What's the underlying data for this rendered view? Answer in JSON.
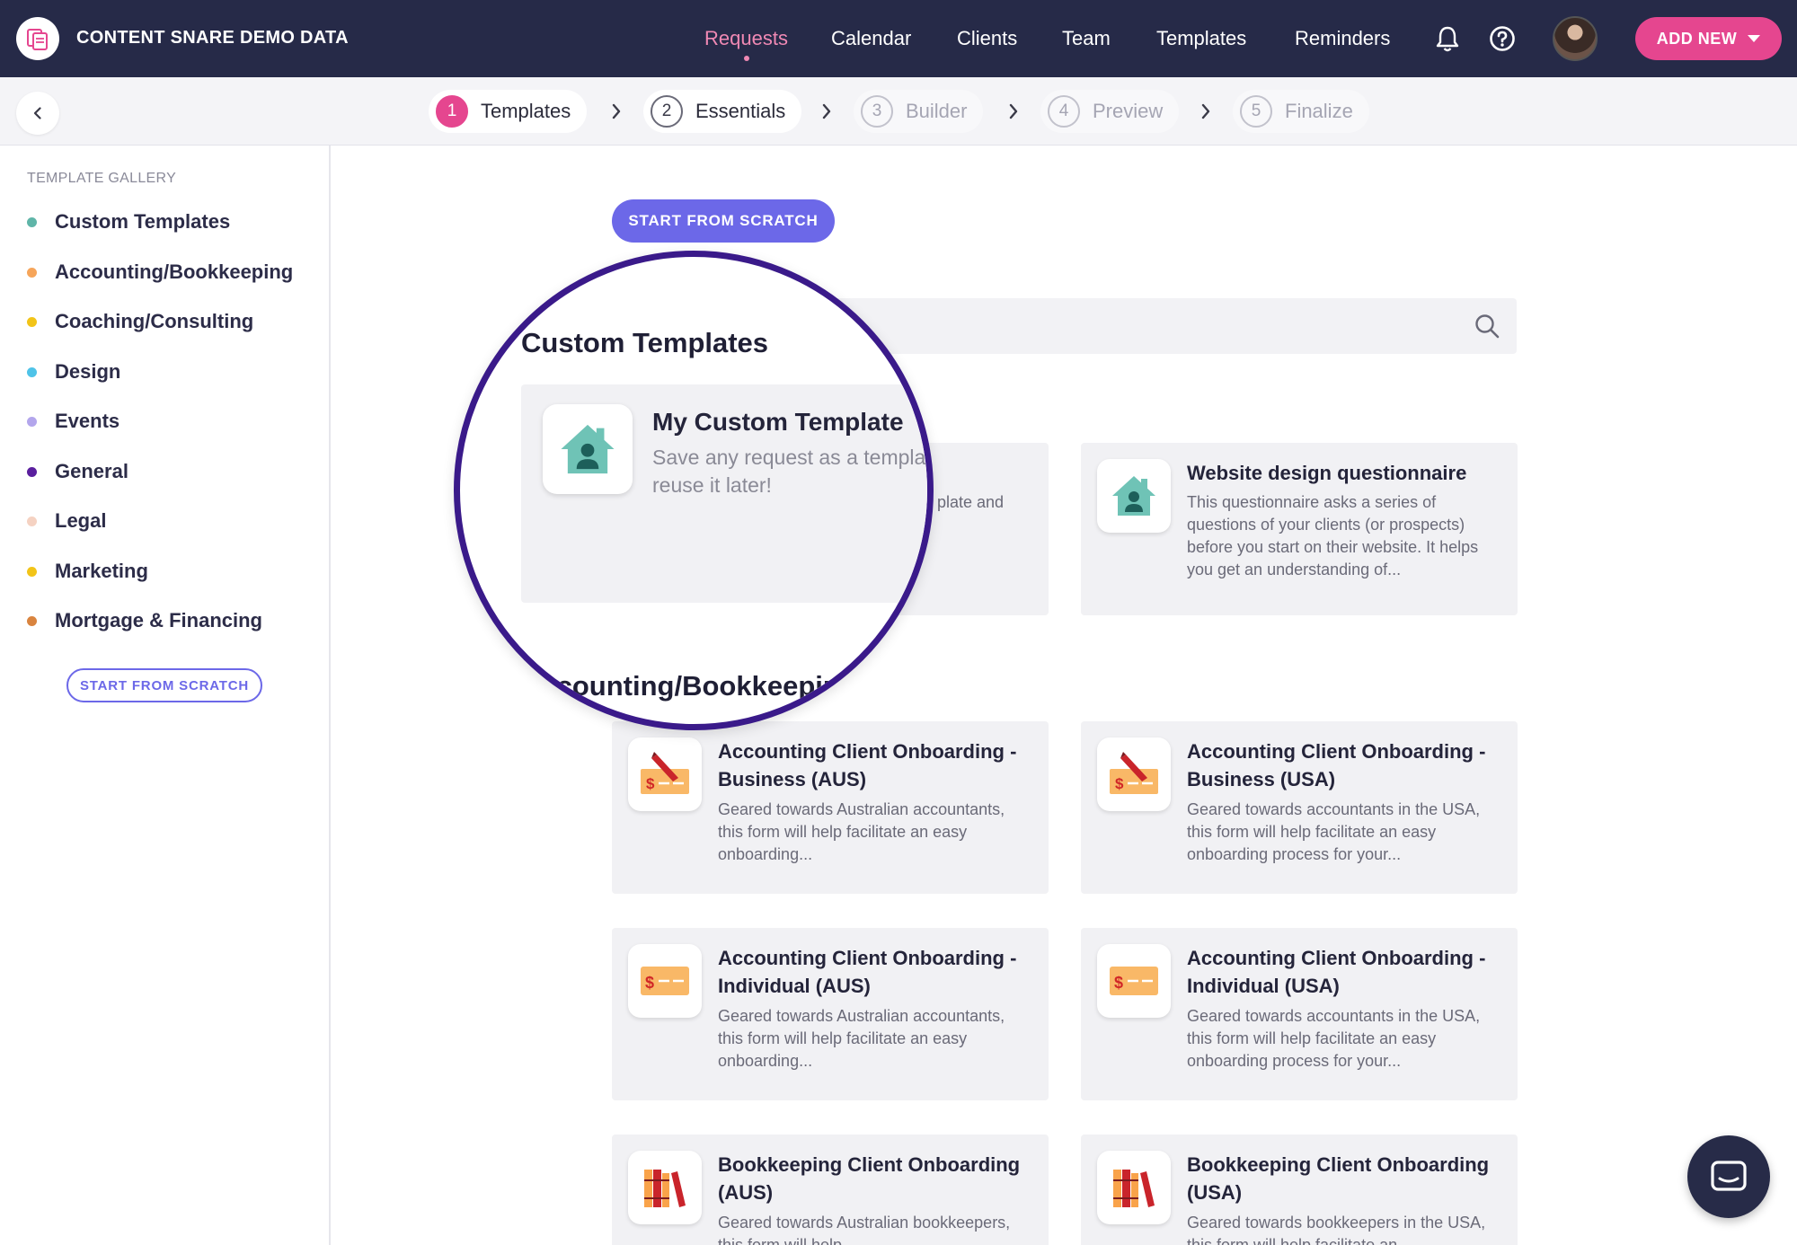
{
  "app": {
    "brand": "CONTENT SNARE DEMO DATA",
    "nav": [
      "Requests",
      "Calendar",
      "Clients",
      "Team",
      "Templates",
      "Reminders"
    ],
    "active_nav": "Requests",
    "add_new": "ADD NEW"
  },
  "stepper": {
    "steps": [
      {
        "num": "1",
        "label": "Templates",
        "state": "active"
      },
      {
        "num": "2",
        "label": "Essentials",
        "state": "done"
      },
      {
        "num": "3",
        "label": "Builder",
        "state": "dim"
      },
      {
        "num": "4",
        "label": "Preview",
        "state": "dim"
      },
      {
        "num": "5",
        "label": "Finalize",
        "state": "dim"
      }
    ]
  },
  "sidebar": {
    "heading": "TEMPLATE GALLERY",
    "categories": [
      {
        "label": "Custom Templates",
        "color": "#5fb5a8"
      },
      {
        "label": "Accounting/Bookkeeping",
        "color": "#f6a55a"
      },
      {
        "label": "Coaching/Consulting",
        "color": "#f2c418"
      },
      {
        "label": "Design",
        "color": "#4fc3e8"
      },
      {
        "label": "Events",
        "color": "#b3a6ec"
      },
      {
        "label": "General",
        "color": "#5a1f9e"
      },
      {
        "label": "Legal",
        "color": "#f5d2c2"
      },
      {
        "label": "Marketing",
        "color": "#f2c418"
      },
      {
        "label": "Mortgage & Financing",
        "color": "#d9843f"
      }
    ],
    "scratch_button": "START FROM SCRATCH"
  },
  "main": {
    "scratch_button": "START FROM SCRATCH",
    "custom_heading": "Custom Templates",
    "accounting_heading": "Accounting/Bookkeeping",
    "custom_cards": [
      {
        "title": "My Custom Template",
        "desc_partial": "plate and",
        "icon": "house-icon"
      },
      {
        "title": "Website design questionnaire",
        "desc": "This questionnaire asks a series of questions of your clients (or prospects) before you start on their website. It helps you get an understanding of...",
        "icon": "house-icon"
      }
    ],
    "accounting_cards": [
      {
        "title": "Accounting Client Onboarding - Business (AUS)",
        "desc": "Geared towards Australian accountants, this form will help facilitate an easy onboarding...",
        "icon": "cheque-pen-icon"
      },
      {
        "title": "Accounting Client Onboarding - Business (USA)",
        "desc": "Geared towards accountants in the USA, this form will help facilitate an easy onboarding process for your...",
        "icon": "cheque-pen-icon"
      },
      {
        "title": "Accounting Client Onboarding - Individual (AUS)",
        "desc": "Geared towards Australian accountants, this form will help facilitate an easy onboarding...",
        "icon": "cheque-icon"
      },
      {
        "title": "Accounting Client Onboarding - Individual (USA)",
        "desc": "Geared towards accountants in the USA, this form will help facilitate an easy onboarding process for your...",
        "icon": "cheque-icon"
      },
      {
        "title": "Bookkeeping Client Onboarding (AUS)",
        "desc": "Geared towards Australian bookkeepers, this form will help",
        "icon": "books-icon"
      },
      {
        "title": "Bookkeeping Client Onboarding (USA)",
        "desc": "Geared towards bookkeepers in the USA, this form will help facilitate an",
        "icon": "books-icon"
      }
    ]
  },
  "magnifier": {
    "heading": "Custom Templates",
    "card_title": "My Custom Template",
    "card_desc": "Save any request as a template and reuse it later!",
    "bottom_heading": "Accounting/Bookkeeping"
  },
  "colors": {
    "nav_bg": "#262a48",
    "accent_pink": "#e5468f",
    "accent_purple": "#6c68e8",
    "magnifier_ring": "#3a1a8a"
  }
}
